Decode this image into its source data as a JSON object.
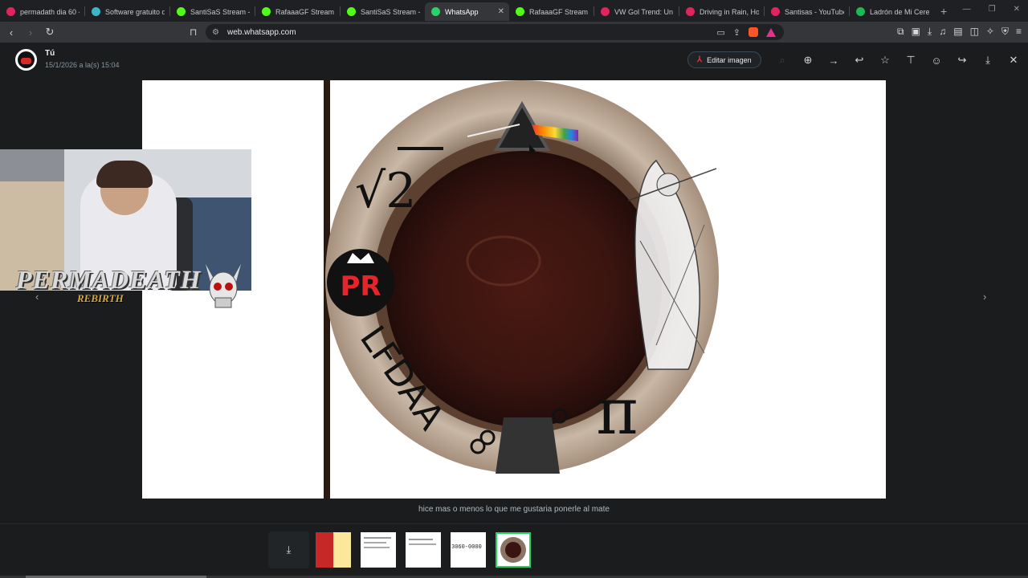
{
  "browser": {
    "tabs": [
      {
        "title": "permadath dia 60 -",
        "color": "#e0245e"
      },
      {
        "title": "Software gratuito de",
        "color": "#3fb4c9"
      },
      {
        "title": "SantiSaS Stream - V",
        "color": "#53fc18"
      },
      {
        "title": "RafaaaGF Stream - V",
        "color": "#53fc18"
      },
      {
        "title": "SantiSaS Stream - V",
        "color": "#53fc18"
      },
      {
        "title": "WhatsApp",
        "color": "#25d366",
        "active": true
      },
      {
        "title": "RafaaaGF Stream - V",
        "color": "#53fc18"
      },
      {
        "title": "VW Gol Trend: Un a",
        "color": "#e0245e"
      },
      {
        "title": "Driving in Rain, Hol",
        "color": "#e0245e"
      },
      {
        "title": "Santisas - YouTube",
        "color": "#e0245e"
      },
      {
        "title": "Ladrón de Mi Cereb",
        "color": "#1db954"
      }
    ],
    "new_tab": "+",
    "url": "web.whatsapp.com"
  },
  "viewer": {
    "sender": "Tú",
    "timestamp": "15/1/2026 a la(s) 15:04",
    "edit_label": "Editar imagen",
    "icons": [
      "search-icon",
      "zoom-in-icon",
      "forward-icon",
      "reply-icon",
      "star-icon",
      "pin-icon",
      "emoji-icon",
      "share-icon",
      "download-icon",
      "close-icon"
    ],
    "caption": "hice mas o menos lo que me gustaria ponerle al mate"
  },
  "image": {
    "root_text": "√2",
    "badge_text": "PR",
    "ring_text": "LFDAA",
    "pi_text": "π"
  },
  "webcam": {
    "overlay_title": "PERMADEATH",
    "overlay_subtitle": "REBIRTH"
  },
  "thumbnails": {
    "items": [
      {
        "kind": "spreadsheet"
      },
      {
        "kind": "document"
      },
      {
        "kind": "document"
      },
      {
        "kind": "text",
        "text": "3060-0000"
      },
      {
        "kind": "mate",
        "active": true
      }
    ]
  }
}
